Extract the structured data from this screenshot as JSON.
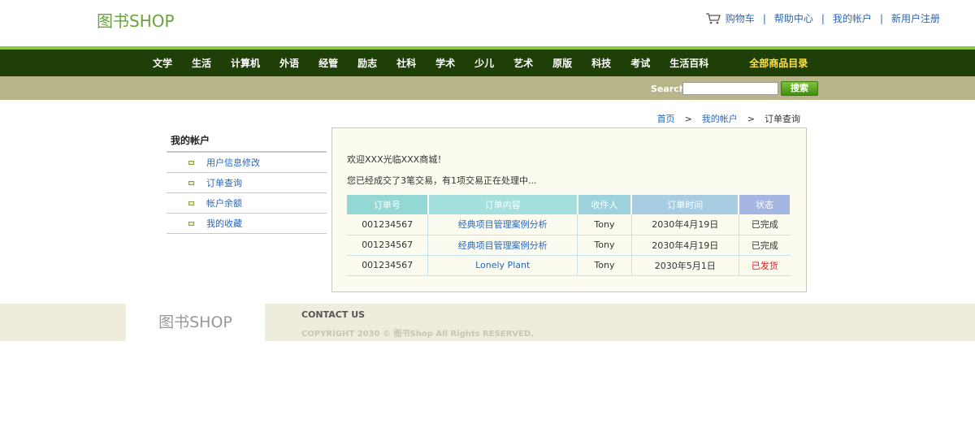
{
  "header": {
    "logo": "图书SHOP",
    "links": [
      "购物车",
      "帮助中心",
      "我的帐户",
      "新用户注册"
    ],
    "separator": "|"
  },
  "nav": {
    "items": [
      "文学",
      "生活",
      "计算机",
      "外语",
      "经管",
      "励志",
      "社科",
      "学术",
      "少儿",
      "艺术",
      "原版",
      "科技",
      "考试",
      "生活百科"
    ],
    "featured": "全部商品目录"
  },
  "search": {
    "label": "Search",
    "value": "",
    "button": "搜索"
  },
  "breadcrumb": {
    "home": "首页",
    "account": "我的帐户",
    "current": "订单查询",
    "arrow": ">"
  },
  "sidebar": {
    "title": "我的帐户",
    "items": [
      "用户信息修改",
      "订单查询",
      "帐户余额",
      "我的收藏"
    ]
  },
  "main": {
    "welcome": "欢迎XXX光临XXX商城！",
    "summary": "您已经成交了3笔交易，有1项交易正在处理中..."
  },
  "orders": {
    "columns": [
      "订单号",
      "订单内容",
      "收件人",
      "订单时间",
      "状态"
    ],
    "rows": [
      {
        "id": "001234567",
        "content": "经典项目管理案例分析",
        "recipient": "Tony",
        "date": "2030年4月19日",
        "status": "已完成"
      },
      {
        "id": "001234567",
        "content": "经典项目管理案例分析",
        "recipient": "Tony",
        "date": "2030年4月19日",
        "status": "已完成"
      },
      {
        "id": "001234567",
        "content": "Lonely Plant",
        "recipient": "Tony",
        "date": "2030年5月1日",
        "status": "已发货"
      }
    ]
  },
  "footer": {
    "logo": "图书SHOP",
    "contact": "CONTACT US",
    "copyright": "COPYRIGHT 2030 © 图书Shop All Rights RESERVED."
  },
  "colors": {
    "nav_bg": "#1e3f08",
    "accent_green": "#8cc63e",
    "search_band": "#b8b58a",
    "link": "#2a67b8",
    "featured": "#ffe04a",
    "status_shipped": "#e02020"
  }
}
